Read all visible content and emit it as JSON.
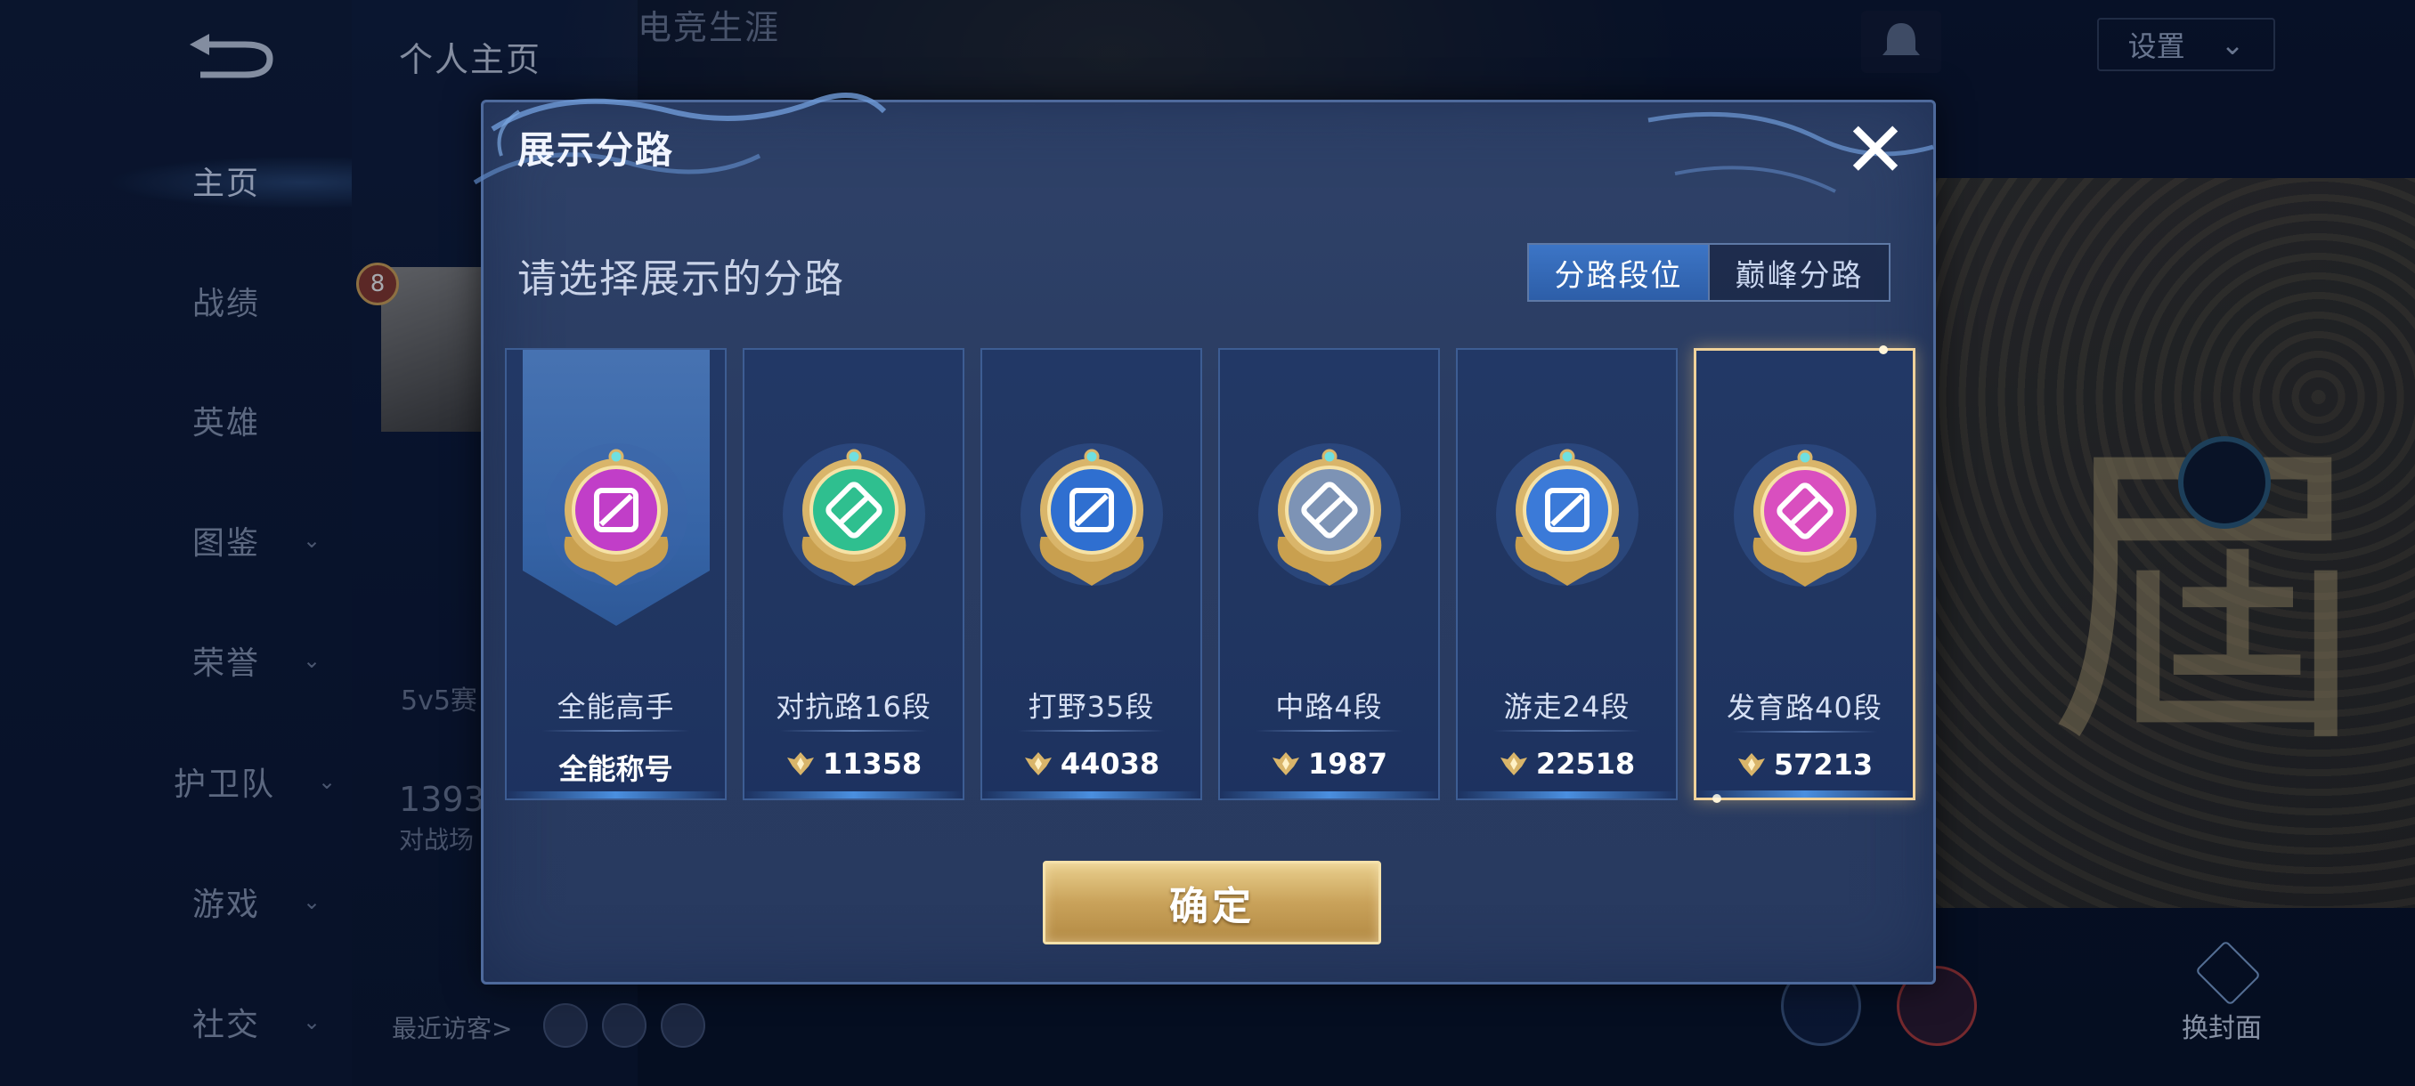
{
  "background": {
    "top_tabs": [
      "个人主页",
      "电竞生涯"
    ],
    "sidebar": [
      {
        "label": "主页",
        "active": true,
        "expandable": false
      },
      {
        "label": "战绩",
        "active": false,
        "expandable": false
      },
      {
        "label": "英雄",
        "active": false,
        "expandable": false
      },
      {
        "label": "图鉴",
        "active": false,
        "expandable": true
      },
      {
        "label": "荣誉",
        "active": false,
        "expandable": true
      },
      {
        "label": "护卫队",
        "active": false,
        "expandable": true
      },
      {
        "label": "游戏",
        "active": false,
        "expandable": true
      },
      {
        "label": "社交",
        "active": false,
        "expandable": true
      }
    ],
    "settings_label": "设置",
    "level": "8",
    "bg_text_1": "5v5赛",
    "bg_text_2": "1393",
    "bg_text_3": "对战场",
    "recent_visitors": "最近访客>",
    "swap_cover": "换封面"
  },
  "modal": {
    "title": "展示分路",
    "prompt": "请选择展示的分路",
    "segments": [
      {
        "label": "分路段位",
        "active": true
      },
      {
        "label": "巅峰分路",
        "active": false
      }
    ],
    "cards": [
      {
        "name": "全能高手",
        "value": "全能称号",
        "has_points_icon": false,
        "emblem_color": "#c13ec8",
        "selected": false,
        "banner": true
      },
      {
        "name": "对抗路16段",
        "value": "11358",
        "has_points_icon": true,
        "emblem_color": "#2fbf8f",
        "selected": false,
        "banner": false
      },
      {
        "name": "打野35段",
        "value": "44038",
        "has_points_icon": true,
        "emblem_color": "#2f6fd0",
        "selected": false,
        "banner": false
      },
      {
        "name": "中路4段",
        "value": "1987",
        "has_points_icon": true,
        "emblem_color": "#7d93b5",
        "selected": false,
        "banner": false
      },
      {
        "name": "游走24段",
        "value": "22518",
        "has_points_icon": true,
        "emblem_color": "#3b7ad8",
        "selected": false,
        "banner": false
      },
      {
        "name": "发育路40段",
        "value": "57213",
        "has_points_icon": true,
        "emblem_color": "#d94fbf",
        "selected": true,
        "banner": false
      }
    ],
    "confirm_label": "确定"
  },
  "colors": {
    "gold": "#d9b56a",
    "modal_bg": "#2c3f66",
    "selected_border": "#f0d29a",
    "active_tab": "#3c75c6"
  }
}
